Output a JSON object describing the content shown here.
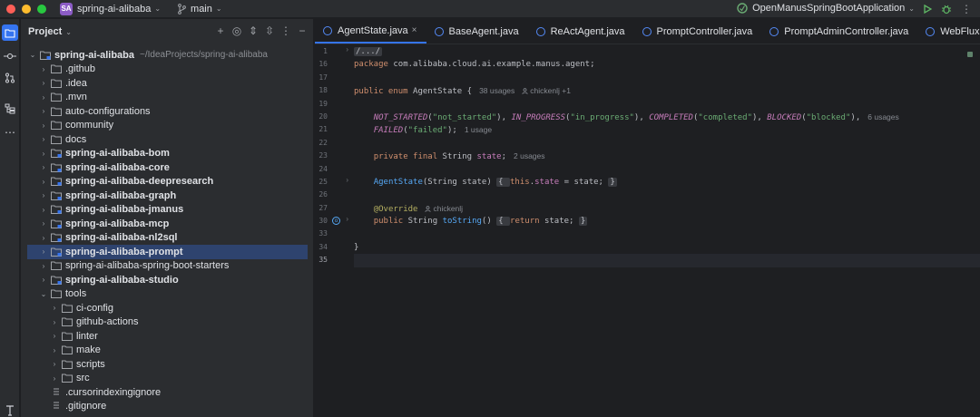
{
  "titlebar": {
    "project_badge": "SA",
    "project_name": "spring-ai-alibaba",
    "branch": "main",
    "run_config": "OpenManusSpringBootApplication"
  },
  "project_panel": {
    "title": "Project",
    "root": {
      "name": "spring-ai-alibaba",
      "path": "~/IdeaProjects/spring-ai-alibaba"
    },
    "items": [
      {
        "label": ".github",
        "bold": false,
        "depth": 1,
        "expanded": false
      },
      {
        "label": ".idea",
        "bold": false,
        "depth": 1,
        "expanded": false
      },
      {
        "label": ".mvn",
        "bold": false,
        "depth": 1,
        "expanded": false
      },
      {
        "label": "auto-configurations",
        "bold": false,
        "depth": 1,
        "expanded": false
      },
      {
        "label": "community",
        "bold": false,
        "depth": 1,
        "expanded": false
      },
      {
        "label": "docs",
        "bold": false,
        "depth": 1,
        "expanded": false
      },
      {
        "label": "spring-ai-alibaba-bom",
        "bold": true,
        "depth": 1,
        "expanded": false
      },
      {
        "label": "spring-ai-alibaba-core",
        "bold": true,
        "depth": 1,
        "expanded": false
      },
      {
        "label": "spring-ai-alibaba-deepresearch",
        "bold": true,
        "depth": 1,
        "expanded": false
      },
      {
        "label": "spring-ai-alibaba-graph",
        "bold": true,
        "depth": 1,
        "expanded": false
      },
      {
        "label": "spring-ai-alibaba-jmanus",
        "bold": true,
        "depth": 1,
        "expanded": false
      },
      {
        "label": "spring-ai-alibaba-mcp",
        "bold": true,
        "depth": 1,
        "expanded": false
      },
      {
        "label": "spring-ai-alibaba-nl2sql",
        "bold": true,
        "depth": 1,
        "expanded": false
      },
      {
        "label": "spring-ai-alibaba-prompt",
        "bold": true,
        "depth": 1,
        "expanded": false,
        "selected": true
      },
      {
        "label": "spring-ai-alibaba-spring-boot-starters",
        "bold": false,
        "depth": 1,
        "expanded": false
      },
      {
        "label": "spring-ai-alibaba-studio",
        "bold": true,
        "depth": 1,
        "expanded": false
      },
      {
        "label": "tools",
        "bold": false,
        "depth": 1,
        "expanded": true
      },
      {
        "label": "ci-config",
        "bold": false,
        "depth": 2,
        "expanded": false
      },
      {
        "label": "github-actions",
        "bold": false,
        "depth": 2,
        "expanded": false
      },
      {
        "label": "linter",
        "bold": false,
        "depth": 2,
        "expanded": false
      },
      {
        "label": "make",
        "bold": false,
        "depth": 2,
        "expanded": false
      },
      {
        "label": "scripts",
        "bold": false,
        "depth": 2,
        "expanded": false
      },
      {
        "label": "src",
        "bold": false,
        "depth": 2,
        "expanded": false
      },
      {
        "label": ".cursorindexingignore",
        "bold": false,
        "depth": 1,
        "file": true
      },
      {
        "label": ".gitignore",
        "bold": false,
        "depth": 1,
        "file": true
      }
    ]
  },
  "tabs": [
    {
      "label": "AgentState.java",
      "active": true
    },
    {
      "label": "BaseAgent.java",
      "active": false
    },
    {
      "label": "ReActAgent.java",
      "active": false
    },
    {
      "label": "PromptController.java",
      "active": false
    },
    {
      "label": "PromptAdminController.java",
      "active": false
    },
    {
      "label": "WebFluxSseClientTransportBuild",
      "active": false
    }
  ],
  "editor": {
    "line_numbers": [
      "1",
      "16",
      "17",
      "18",
      "19",
      "20",
      "21",
      "22",
      "23",
      "24",
      "25",
      "26",
      "27",
      "30",
      "33",
      "34",
      "35"
    ],
    "code": {
      "fold_header": "/.../",
      "package_kw": "package",
      "package_name": " com.alibaba.cloud.ai.example.manus.agent;",
      "enum_decl": "public enum ",
      "enum_name": "AgentState",
      "enum_brace": " {",
      "hint_usages": "38 usages",
      "hint_author": "chickenlj +1",
      "c1_name": "NOT_STARTED",
      "c1_val": "\"not_started\"",
      "c2_name": "IN_PROGRESS",
      "c2_val": "\"in_progress\"",
      "c3_name": "COMPLETED",
      "c3_val": "\"completed\"",
      "c4_name": "BLOCKED",
      "c4_val": "\"blocked\"",
      "hint_6usages": "6 usages",
      "c5_name": "FAILED",
      "c5_val": "\"failed\"",
      "hint_1usage": "1 usage",
      "field_kw": "private final ",
      "field_type": "String ",
      "field_name": "state",
      "hint_2usages": "2 usages",
      "ctor_name": "AgentState",
      "ctor_params": "(String state) ",
      "ctor_body_open": "{ ",
      "ctor_this": "this",
      "ctor_dot": ".",
      "ctor_field": "state",
      "ctor_assign": " = state; ",
      "ctor_body_close": "}",
      "annotation": "@Override",
      "hint_override_author": "chickenlj",
      "method_kw": "public ",
      "method_type": "String ",
      "method_name": "toString",
      "method_parens": "() ",
      "method_body_open": "{ ",
      "method_return": "return ",
      "method_ret_val": "state; ",
      "method_body_close": "}",
      "closing_brace": "}"
    }
  }
}
